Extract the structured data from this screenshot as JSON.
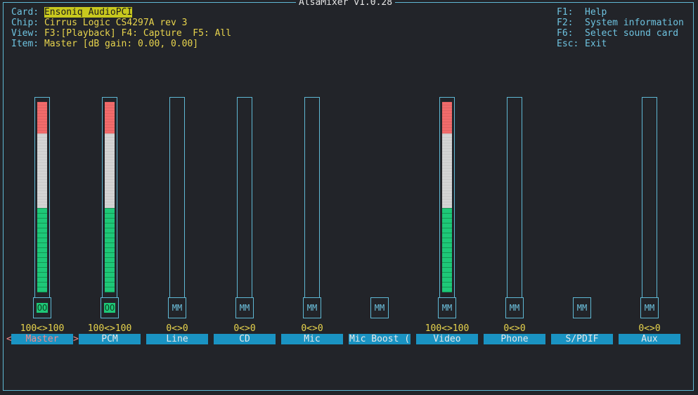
{
  "app_title": "AlsaMixer v1.0.28",
  "info": {
    "card_label": "Card:",
    "card_value": "Ensoniq AudioPCI",
    "chip_label": "Chip:",
    "chip_value": "Cirrus Logic CS4297A rev 3",
    "view_label": "View:",
    "view_playback": "F3:[Playback]",
    "view_capture": "F4: Capture",
    "view_all": "F5: All",
    "item_label": "Item:",
    "item_value": "Master [dB gain: 0.00, 0.00]"
  },
  "help": [
    {
      "key": "F1:",
      "text": "Help"
    },
    {
      "key": "F2:",
      "text": "System information"
    },
    {
      "key": "F6:",
      "text": "Select sound card"
    },
    {
      "key": "Esc:",
      "text": "Exit"
    }
  ],
  "selection_arrows": {
    "left": "<",
    "right": ">"
  },
  "channels": [
    {
      "name": "Master",
      "level": "100<>100",
      "mute": "OO",
      "has_bar": true,
      "filled": true,
      "selected": true
    },
    {
      "name": "PCM",
      "level": "100<>100",
      "mute": "OO",
      "has_bar": true,
      "filled": true,
      "selected": false
    },
    {
      "name": "Line",
      "level": "0<>0",
      "mute": "MM",
      "has_bar": true,
      "filled": false,
      "selected": false
    },
    {
      "name": "CD",
      "level": "0<>0",
      "mute": "MM",
      "has_bar": true,
      "filled": false,
      "selected": false
    },
    {
      "name": "Mic",
      "level": "0<>0",
      "mute": "MM",
      "has_bar": true,
      "filled": false,
      "selected": false
    },
    {
      "name": "Mic Boost (",
      "level": "",
      "mute": "MM",
      "has_bar": false,
      "filled": false,
      "selected": false
    },
    {
      "name": "Video",
      "level": "100<>100",
      "mute": "MM",
      "has_bar": true,
      "filled": true,
      "selected": false
    },
    {
      "name": "Phone",
      "level": "0<>0",
      "mute": "MM",
      "has_bar": true,
      "filled": false,
      "selected": false
    },
    {
      "name": "S/PDIF",
      "level": "",
      "mute": "MM",
      "has_bar": false,
      "filled": false,
      "selected": false
    },
    {
      "name": "Aux",
      "level": "0<>0",
      "mute": "MM",
      "has_bar": true,
      "filled": false,
      "selected": false
    }
  ]
}
